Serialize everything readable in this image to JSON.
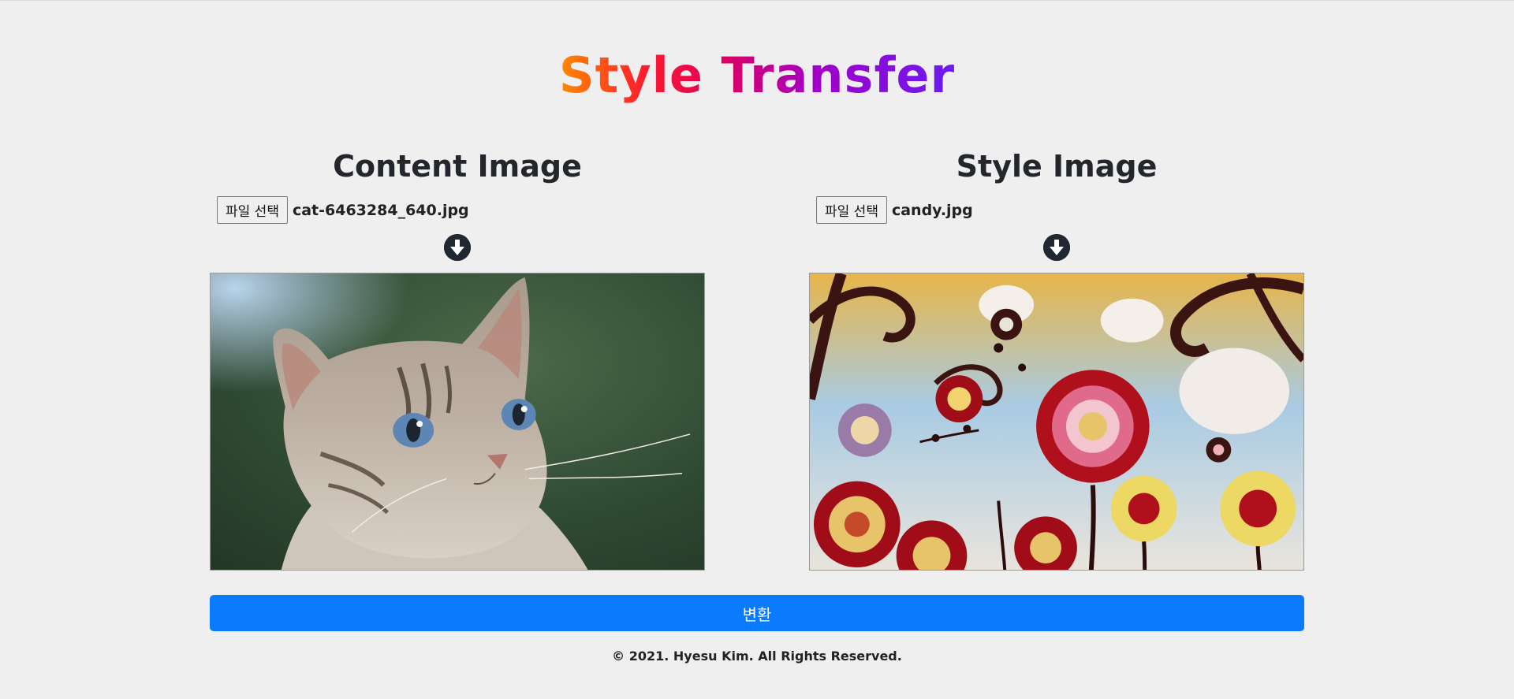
{
  "page": {
    "title": "Style Transfer"
  },
  "content_panel": {
    "heading": "Content Image",
    "file_button_label": "파일 선택",
    "file_name": "cat-6463284_640.jpg",
    "arrow_icon": "circle-arrow-down-icon",
    "image": "cat photo"
  },
  "style_panel": {
    "heading": "Style Image",
    "file_button_label": "파일 선택",
    "file_name": "candy.jpg",
    "arrow_icon": "circle-arrow-down-icon",
    "image": "candy painting"
  },
  "actions": {
    "convert_label": "변환"
  },
  "footer": {
    "copyright": "© 2021. Hyesu Kim. All Rights Reserved."
  },
  "colors": {
    "background": "#f0eff0",
    "primary": "#0a7bfd",
    "title_gradient": [
      "#ff8a00",
      "#ff1a2e",
      "#e0005a",
      "#a100c8",
      "#6a1cf2"
    ]
  }
}
